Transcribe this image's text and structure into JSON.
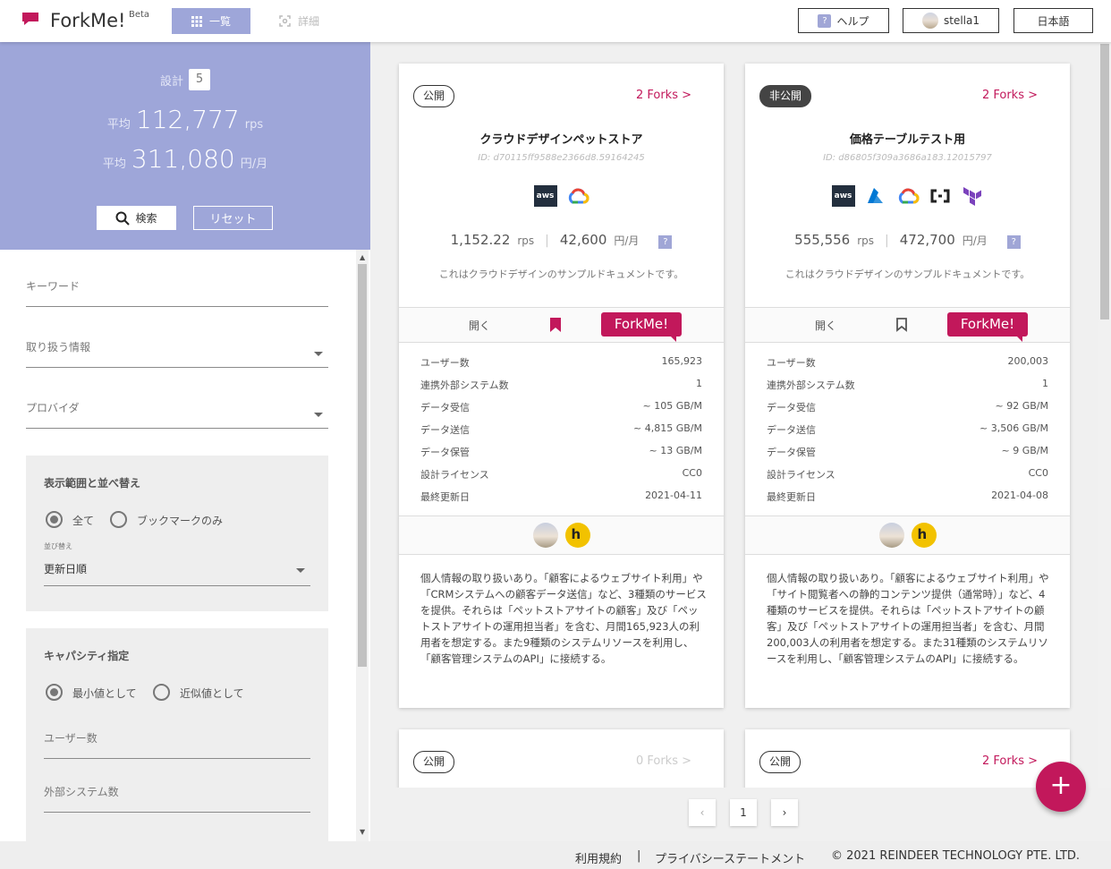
{
  "header": {
    "app_title": "ForkMe!",
    "beta": "Beta",
    "tab_list": "一覧",
    "tab_detail": "詳細",
    "help": "ヘルプ",
    "help_icon": "?",
    "user": "stella1",
    "language": "日本語"
  },
  "summary": {
    "designs_label": "設計",
    "designs_count": "5",
    "avg_label": "平均",
    "avg_rps": "112,777",
    "rps_unit": "rps",
    "avg_cost": "311,080",
    "cost_unit": "円/月",
    "search_button": "検索",
    "reset_button": "リセット"
  },
  "filters": {
    "keyword": "キーワード",
    "info_handled": "取り扱う情報",
    "provider": "プロバイダ",
    "range_title": "表示範囲と並べ替え",
    "radio_all": "全て",
    "radio_bookmarks": "ブックマークのみ",
    "sort_label": "並び替え",
    "sort_value": "更新日順",
    "capacity_title": "キャパシティ指定",
    "radio_min": "最小値として",
    "radio_approx": "近似値として",
    "users_field": "ユーザー数",
    "external_field": "外部システム数"
  },
  "spec_labels": [
    "ユーザー数",
    "連携外部システム数",
    "データ受信",
    "データ送信",
    "データ保管",
    "設計ライセンス",
    "最終更新日"
  ],
  "cards": [
    {
      "visibility": "公開",
      "forks": "2 Forks >",
      "title": "クラウドデザインペットストア",
      "id": "ID: d70115ff9588e2366d8.59164245",
      "providers": [
        "aws",
        "google-cloud"
      ],
      "rps": "1,152.22",
      "rps_unit": "rps",
      "cost": "42,600",
      "cost_unit": "円/月",
      "help_icon": "?",
      "description": "これはクラウドデザインのサンプルドキュメントです。",
      "open": "開く",
      "forkme": "ForkMe!",
      "bookmarked": true,
      "spec_values": [
        "165,923",
        "1",
        "~ 105 GB/M",
        "~ 4,815 GB/M",
        "~ 13 GB/M",
        "CC0",
        "2021-04-11"
      ],
      "long_description": "個人情報の取り扱いあり。「顧客によるウェブサイト利用」や「CRMシステムへの顧客データ送信」など、3種類のサービスを提供。それらは「ペットストアサイトの顧客」及び「ペットストアサイトの運用担当者」を含む、月間165,923人の利用者を想定する。また9種類のシステムリソースを利用し、「顧客管理システムのAPI」に接続する。"
    },
    {
      "visibility": "非公開",
      "forks": "2 Forks >",
      "title": "価格テーブルテスト用",
      "id": "ID: d86805f309a3686a183.12015797",
      "providers": [
        "aws",
        "azure",
        "google-cloud",
        "api",
        "terraform"
      ],
      "rps": "555,556",
      "rps_unit": "rps",
      "cost": "472,700",
      "cost_unit": "円/月",
      "help_icon": "?",
      "description": "これはクラウドデザインのサンプルドキュメントです。",
      "open": "開く",
      "forkme": "ForkMe!",
      "bookmarked": false,
      "spec_values": [
        "200,003",
        "1",
        "~ 92 GB/M",
        "~ 3,506 GB/M",
        "~ 9 GB/M",
        "CC0",
        "2021-04-08"
      ],
      "long_description": "個人情報の取り扱いあり。「顧客によるウェブサイト利用」や「サイト閲覧者への静的コンテンツ提供（通常時）」など、4種類のサービスを提供。それらは「ペットストアサイトの顧客」及び「ペットストアサイトの運用担当者」を含む、月間200,003人の利用者を想定する。また31種類のシステムリソースを利用し、「顧客管理システムのAPI」に接続する。"
    },
    {
      "visibility": "公開",
      "forks": "0 Forks >"
    },
    {
      "visibility": "公開",
      "forks": "2 Forks >"
    }
  ],
  "pagination": {
    "prev": "‹",
    "page": "1",
    "next": "›"
  },
  "fab": "+",
  "footer": {
    "terms": "利用規約",
    "separator": "|",
    "privacy": "プライバシーステートメント",
    "copyright": "© 2021 REINDEER TECHNOLOGY PTE. LTD."
  },
  "colors": {
    "accent": "#c2185b",
    "primary": "#9ea6d9"
  }
}
